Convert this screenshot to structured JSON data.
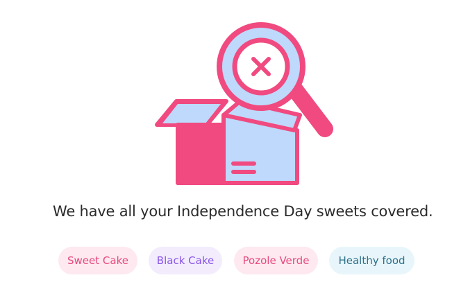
{
  "empty_state": {
    "illustration_icon": "empty-box-with-magnifier-x-icon",
    "headline": "We have all your Independence Day sweets covered."
  },
  "tags": [
    {
      "label": "Sweet Cake"
    },
    {
      "label": "Black Cake"
    },
    {
      "label": "Pozole Verde"
    },
    {
      "label": "Healthy food"
    }
  ],
  "colors": {
    "pink": "#f04a80",
    "light_blue": "#bed9fb",
    "tag_pink_bg": "#fde9ef",
    "tag_pink_text": "#e8497e",
    "tag_purple_bg": "#f2ecfd",
    "tag_purple_text": "#8a55e8",
    "tag_blue_bg": "#e8f6fb",
    "tag_blue_text": "#2b6f88"
  }
}
